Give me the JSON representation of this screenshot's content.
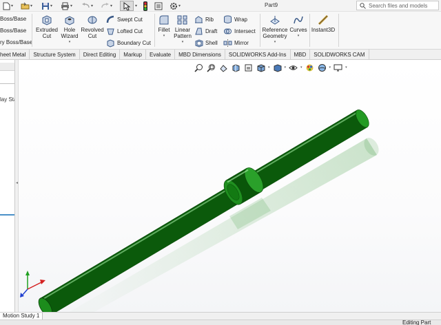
{
  "titlebar": {
    "document_title": "Part9",
    "search_placeholder": "Search files and models"
  },
  "ribbon": {
    "left_cut_items": [
      "Boss/Base",
      "Boss/Base",
      "ry Boss/Base"
    ],
    "extruded_cut": [
      "Extruded",
      "Cut"
    ],
    "hole_wizard": [
      "Hole",
      "Wizard"
    ],
    "revolved_cut": [
      "Revolved",
      "Cut"
    ],
    "swept_cut": "Swept Cut",
    "lofted_cut": "Lofted Cut",
    "boundary_cut": "Boundary Cut",
    "fillet": "Fillet",
    "linear_pattern": [
      "Linear",
      "Pattern"
    ],
    "rib": "Rib",
    "draft": "Draft",
    "shell": "Shell",
    "wrap": "Wrap",
    "intersect": "Intersect",
    "mirror": "Mirror",
    "reference_geometry": [
      "Reference",
      "Geometry"
    ],
    "curves": "Curves",
    "instant3d": "Instant3D"
  },
  "tabs": [
    "heet Metal",
    "Structure System",
    "Direct Editing",
    "Markup",
    "Evaluate",
    "MBD Dimensions",
    "SOLIDWORKS Add-Ins",
    "MBD",
    "SOLIDWORKS CAM"
  ],
  "left_panel": {
    "label": "lay Sta"
  },
  "bottom_tabs": [
    "Motion Study 1"
  ],
  "status": {
    "text": "Editing Part"
  },
  "colors": {
    "model_green": "#1e8a1e",
    "model_dark": "#0b5a0b",
    "model_light": "#6fd46f",
    "axis_x": "#d42020",
    "axis_y": "#20a020",
    "axis_z": "#2040d0"
  }
}
